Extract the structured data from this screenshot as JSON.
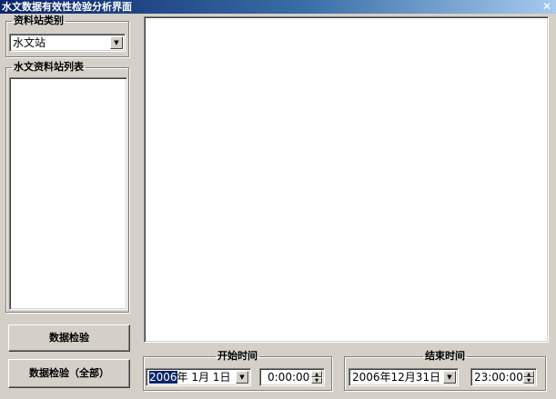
{
  "window": {
    "title": "水文数据有效性检验分析界面",
    "close_glyph": "✕"
  },
  "station_category": {
    "legend": "资料站类别",
    "selected": "水文站"
  },
  "station_list": {
    "legend": "水文资料站列表",
    "items": []
  },
  "buttons": {
    "check": "数据检验",
    "check_all": "数据检验（全部）"
  },
  "start_time": {
    "legend": "开始时间",
    "date_year": "2006",
    "date_rest": "年  1月  1日",
    "time": "0:00:00"
  },
  "end_time": {
    "legend": "结束时间",
    "date": "2006年12月31日",
    "time": "23:00:00"
  }
}
